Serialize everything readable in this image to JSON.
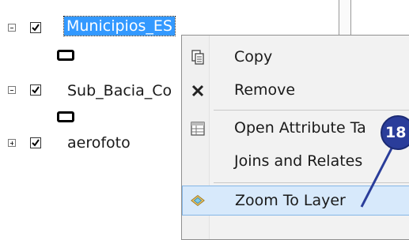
{
  "toc": {
    "layers": [
      {
        "name": "Municipios_ES",
        "checked": true,
        "expanded": true,
        "selected": true
      },
      {
        "name": "Sub_Bacia_Co",
        "checked": true,
        "expanded": true,
        "selected": false
      },
      {
        "name": "aerofoto",
        "checked": true,
        "expanded": false,
        "selected": false
      }
    ]
  },
  "context_menu": {
    "items": [
      {
        "label": "Copy",
        "icon": "copy-icon"
      },
      {
        "label": "Remove",
        "icon": "remove-icon"
      },
      {
        "label": "Open Attribute Ta",
        "icon": "attribute-table-icon"
      },
      {
        "label": "Joins and Relates",
        "icon": ""
      },
      {
        "label": "Zoom To Layer",
        "icon": "zoom-to-layer-icon",
        "highlighted": true
      }
    ]
  },
  "callout": {
    "number": "18"
  },
  "colors": {
    "selection": "#3399ff",
    "menu_highlight": "#d7e9fb",
    "callout": "#2a3d9a"
  }
}
